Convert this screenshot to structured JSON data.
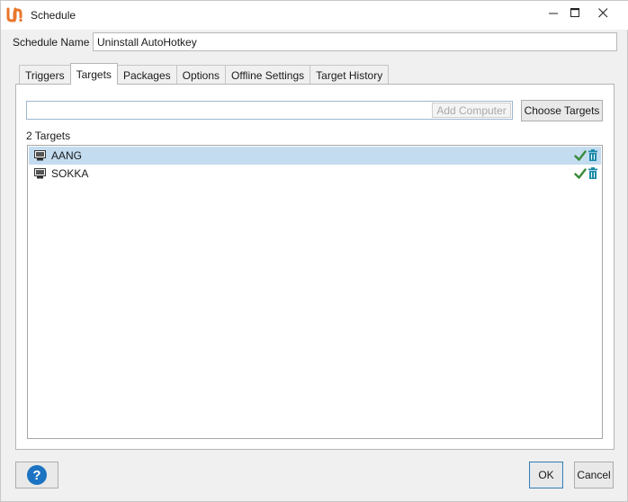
{
  "window": {
    "title": "Schedule",
    "controls": {
      "minimize": "—",
      "maximize": "☐",
      "close": "✕"
    }
  },
  "schedule": {
    "label": "Schedule Name",
    "value": "Uninstall AutoHotkey"
  },
  "tabs": [
    {
      "label": "Triggers",
      "active": false
    },
    {
      "label": "Targets",
      "active": true
    },
    {
      "label": "Packages",
      "active": false
    },
    {
      "label": "Options",
      "active": false
    },
    {
      "label": "Offline Settings",
      "active": false
    },
    {
      "label": "Target History",
      "active": false
    }
  ],
  "targets_tab": {
    "computer_input_value": "",
    "add_computer_label": "Add Computer",
    "choose_targets_label": "Choose Targets",
    "count_label": "2 Targets",
    "targets": [
      {
        "name": "AANG",
        "selected": true,
        "status_icon": "check-icon",
        "action_icon": "trash-icon"
      },
      {
        "name": "SOKKA",
        "selected": false,
        "status_icon": "check-icon",
        "action_icon": "trash-icon"
      }
    ]
  },
  "footer": {
    "help_icon": "help-icon",
    "ok_label": "OK",
    "cancel_label": "Cancel"
  },
  "colors": {
    "brand_orange": "#e8762b",
    "selection_blue": "#c4dcf0",
    "check_green": "#3a8a3a",
    "trash_teal": "#1b8aa8",
    "help_blue": "#1b73c2"
  }
}
